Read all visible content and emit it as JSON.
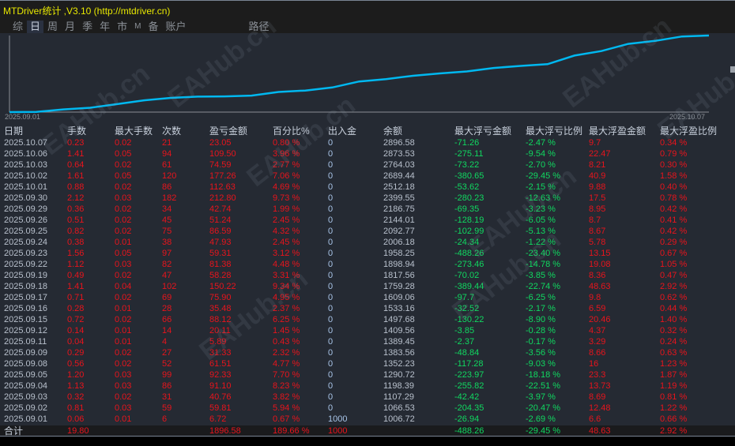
{
  "window": {
    "title": "MTDriver统计 ,V3.10 (http://mtdriver.cn)"
  },
  "tabs": [
    {
      "label": "综"
    },
    {
      "label": "日",
      "active": true
    },
    {
      "label": "周"
    },
    {
      "label": "月"
    },
    {
      "label": "季"
    },
    {
      "label": "年"
    },
    {
      "label": "市"
    },
    {
      "label": "M"
    },
    {
      "label": "备"
    },
    {
      "label": "账户"
    },
    {
      "label": "路径"
    }
  ],
  "chart": {
    "start_label": "2025.09.01",
    "end_label": "2025.10.07",
    "line_color": "#00b8f0"
  },
  "watermark": "EAHub.cn",
  "table": {
    "headers": [
      "日期",
      "手数",
      "最大手数",
      "次数",
      "盈亏金额",
      "百分比%",
      "出入金",
      "余额",
      "最大浮亏金额",
      "最大浮亏比例",
      "最大浮盈金额",
      "最大浮盈比例"
    ],
    "rows": [
      [
        "2025.10.07",
        "0.23",
        "0.02",
        "21",
        "23.05",
        "0.80 %",
        "0",
        "2896.58",
        "-71.26",
        "-2.47 %",
        "9.7",
        "0.34 %"
      ],
      [
        "2025.10.06",
        "1.41",
        "0.05",
        "94",
        "109.50",
        "3.96 %",
        "0",
        "2873.53",
        "-275.11",
        "-9.54 %",
        "22.47",
        "0.79 %"
      ],
      [
        "2025.10.03",
        "0.64",
        "0.02",
        "61",
        "74.59",
        "2.77 %",
        "0",
        "2764.03",
        "-73.22",
        "-2.70 %",
        "8.21",
        "0.30 %"
      ],
      [
        "2025.10.02",
        "1.61",
        "0.05",
        "120",
        "177.26",
        "7.06 %",
        "0",
        "2689.44",
        "-380.65",
        "-29.45 %",
        "40.9",
        "1.58 %"
      ],
      [
        "2025.10.01",
        "0.88",
        "0.02",
        "86",
        "112.63",
        "4.69 %",
        "0",
        "2512.18",
        "-53.62",
        "-2.15 %",
        "9.88",
        "0.40 %"
      ],
      [
        "2025.09.30",
        "2.12",
        "0.03",
        "182",
        "212.80",
        "9.73 %",
        "0",
        "2399.55",
        "-280.23",
        "-12.63 %",
        "17.5",
        "0.78 %"
      ],
      [
        "2025.09.29",
        "0.36",
        "0.02",
        "34",
        "42.74",
        "1.99 %",
        "0",
        "2186.75",
        "-69.35",
        "-3.23 %",
        "8.95",
        "0.42 %"
      ],
      [
        "2025.09.26",
        "0.51",
        "0.02",
        "45",
        "51.24",
        "2.45 %",
        "0",
        "2144.01",
        "-128.19",
        "-6.05 %",
        "8.7",
        "0.41 %"
      ],
      [
        "2025.09.25",
        "0.82",
        "0.02",
        "75",
        "86.59",
        "4.32 %",
        "0",
        "2092.77",
        "-102.99",
        "-5.13 %",
        "8.67",
        "0.42 %"
      ],
      [
        "2025.09.24",
        "0.38",
        "0.01",
        "38",
        "47.93",
        "2.45 %",
        "0",
        "2006.18",
        "-24.34",
        "-1.22 %",
        "5.78",
        "0.29 %"
      ],
      [
        "2025.09.23",
        "1.56",
        "0.05",
        "97",
        "59.31",
        "3.12 %",
        "0",
        "1958.25",
        "-488.26",
        "-23.40 %",
        "13.15",
        "0.67 %"
      ],
      [
        "2025.09.22",
        "1.12",
        "0.03",
        "82",
        "81.38",
        "4.48 %",
        "0",
        "1898.94",
        "-273.46",
        "-14.78 %",
        "19.08",
        "1.05 %"
      ],
      [
        "2025.09.19",
        "0.49",
        "0.02",
        "47",
        "58.28",
        "3.31 %",
        "0",
        "1817.56",
        "-70.02",
        "-3.85 %",
        "8.36",
        "0.47 %"
      ],
      [
        "2025.09.18",
        "1.41",
        "0.04",
        "102",
        "150.22",
        "9.34 %",
        "0",
        "1759.28",
        "-389.44",
        "-22.74 %",
        "48.63",
        "2.92 %"
      ],
      [
        "2025.09.17",
        "0.71",
        "0.02",
        "69",
        "75.90",
        "4.95 %",
        "0",
        "1609.06",
        "-97.7",
        "-6.25 %",
        "9.8",
        "0.62 %"
      ],
      [
        "2025.09.16",
        "0.28",
        "0.01",
        "28",
        "35.48",
        "2.37 %",
        "0",
        "1533.16",
        "-32.52",
        "-2.17 %",
        "6.59",
        "0.44 %"
      ],
      [
        "2025.09.15",
        "0.72",
        "0.02",
        "66",
        "88.12",
        "6.25 %",
        "0",
        "1497.68",
        "-130.22",
        "-8.90 %",
        "20.46",
        "1.40 %"
      ],
      [
        "2025.09.12",
        "0.14",
        "0.01",
        "14",
        "20.11",
        "1.45 %",
        "0",
        "1409.56",
        "-3.85",
        "-0.28 %",
        "4.37",
        "0.32 %"
      ],
      [
        "2025.09.11",
        "0.04",
        "0.01",
        "4",
        "5.89",
        "0.43 %",
        "0",
        "1389.45",
        "-2.37",
        "-0.17 %",
        "3.29",
        "0.24 %"
      ],
      [
        "2025.09.09",
        "0.29",
        "0.02",
        "27",
        "31.33",
        "2.32 %",
        "0",
        "1383.56",
        "-48.84",
        "-3.56 %",
        "8.66",
        "0.63 %"
      ],
      [
        "2025.09.08",
        "0.56",
        "0.02",
        "52",
        "61.51",
        "4.77 %",
        "0",
        "1352.23",
        "-117.28",
        "-9.03 %",
        "16",
        "1.23 %"
      ],
      [
        "2025.09.05",
        "1.20",
        "0.03",
        "99",
        "92.33",
        "7.70 %",
        "0",
        "1290.72",
        "-223.97",
        "-18.18 %",
        "23.3",
        "1.87 %"
      ],
      [
        "2025.09.04",
        "1.13",
        "0.03",
        "86",
        "91.10",
        "8.23 %",
        "0",
        "1198.39",
        "-255.82",
        "-22.51 %",
        "13.73",
        "1.19 %"
      ],
      [
        "2025.09.03",
        "0.32",
        "0.02",
        "31",
        "40.76",
        "3.82 %",
        "0",
        "1107.29",
        "-42.42",
        "-3.97 %",
        "8.69",
        "0.81 %"
      ],
      [
        "2025.09.02",
        "0.81",
        "0.03",
        "59",
        "59.81",
        "5.94 %",
        "0",
        "1066.53",
        "-204.35",
        "-20.47 %",
        "12.48",
        "1.22 %"
      ],
      [
        "2025.09.01",
        "0.06",
        "0.01",
        "6",
        "6.72",
        "0.67 %",
        "1000",
        "1006.72",
        "-26.94",
        "-2.69 %",
        "6.6",
        "0.66 %"
      ]
    ],
    "total": [
      "合计",
      "19.80",
      "",
      "",
      "1896.58",
      "189.66 %",
      "1000",
      "",
      "-488.26",
      "-29.45 %",
      "48.63",
      "2.92 %"
    ]
  }
}
